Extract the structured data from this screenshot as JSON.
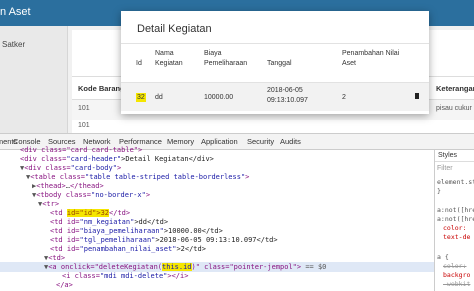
{
  "app": {
    "brand": "n Aset",
    "side_item": "Satker",
    "table": {
      "headers": [
        "Kode Barang",
        "Keterangan"
      ],
      "row1": {
        "code": "101",
        "keterangan": "pisau cukur"
      },
      "row2": {
        "code": "101"
      }
    }
  },
  "modal": {
    "title": "Detail Kegiatan",
    "headers": {
      "id": "Id",
      "nama_l1": "Nama",
      "nama_l2": "Kegiatan",
      "biaya_l1": "Biaya",
      "biaya_l2": "Pemeliharaan",
      "tanggal": "Tanggal",
      "penambahan_l1": "Penambahan Nilai",
      "penambahan_l2": "Aset"
    },
    "row": {
      "id": "32",
      "nama": "dd",
      "biaya": "10000.00",
      "tanggal_l1": "2018-06-05",
      "tanggal_l2": "09:13:10.097",
      "penambahan": "2"
    }
  },
  "devtools": {
    "tabs": [
      "Elements",
      "Console",
      "Sources",
      "Network",
      "Performance",
      "Memory",
      "Application",
      "Security",
      "Audits"
    ],
    "lines": {
      "l0": {
        "open": "<div class=\"card card-table\">"
      },
      "l1": {
        "open": "<div class=",
        "val": "\"card-header\"",
        "text": ">Detail Kegiatan</div>"
      },
      "l2": {
        "open": "<div class=",
        "val": "\"card-body\"",
        "close": ">"
      },
      "l3": {
        "open": "<table class=",
        "val": "\"table table-striped table-borderless\"",
        "close": ">"
      },
      "l4": {
        "open": "<thead>",
        "dots": "…",
        "close": "</thead>"
      },
      "l5": {
        "open": "<tbody class=",
        "val": "\"no-border-x\"",
        "close": ">"
      },
      "l6": {
        "open": "<tr>"
      },
      "l7": {
        "pre": "<td ",
        "hl": "id=\"id\">32",
        "post": "</td>"
      },
      "l8": {
        "open": "<td id=",
        "val": "\"nm_kegiatan\"",
        "text": ">dd</td>"
      },
      "l9": {
        "open": "<td id=",
        "val": "\"biaya_pemeliharaan\"",
        "text": ">10000.00</td>"
      },
      "l10": {
        "open": "<td id=",
        "val": "\"tgl_pemeliharaan\"",
        "text": ">2018-06-05 09:13:10.097</td>"
      },
      "l11": {
        "open": "<td id=",
        "val": "\"penambahan_nilai_aset\"",
        "text": ">2</td>"
      },
      "l12": {
        "open": "<td>"
      },
      "l13": {
        "pre": "<a onclick=\"deleteKegiatan(",
        "hl": "this.id",
        "post": ")\" class=\"pointer-jempol\">",
        "eq": " == $0"
      },
      "l14": {
        "open": "<i class=",
        "val": "\"mdi mdi-delete\"",
        "close": "></i>"
      },
      "l15": {
        "open": "</a>"
      }
    },
    "styles": {
      "tab": "Styles",
      "filter": "Filter",
      "rule1": "element.st",
      "rule2": "}",
      "rule3": "a:not([hre",
      "rule4": "a:not([hre",
      "prop1": "color:",
      "prop2": "text-de",
      "rule5": "a {",
      "prop3": "color:",
      "prop4": "backgro",
      "prop5": "-webkit"
    }
  }
}
